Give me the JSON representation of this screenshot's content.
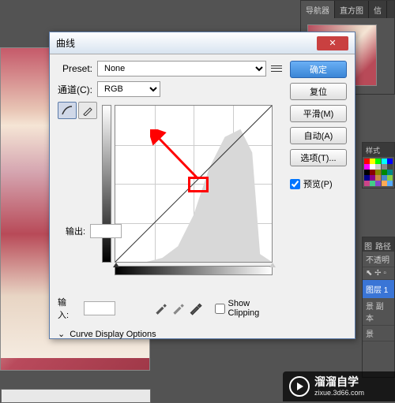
{
  "nav": {
    "tabs": [
      "导航器",
      "直方图",
      "信"
    ]
  },
  "color_panel": {
    "tab": "样式"
  },
  "layers": {
    "tab1": "图",
    "tab2": "路径",
    "opacity_label": "不透明",
    "layer1": "图层 1",
    "layer2": "景 副本",
    "layer3": "景"
  },
  "dialog": {
    "title": "曲线",
    "preset_label": "Preset:",
    "preset_value": "None",
    "channel_label": "通道(C):",
    "channel_value": "RGB",
    "output_label": "输出:",
    "input_label": "输入:",
    "show_clipping": "Show Clipping",
    "curve_options": "Curve Display Options",
    "buttons": {
      "ok": "确定",
      "reset": "复位",
      "smooth": "平滑(M)",
      "auto": "自动(A)",
      "options": "选项(T)..."
    },
    "preview_label": "预览(P)"
  },
  "chart_data": {
    "type": "line",
    "title": "Curves",
    "xlabel": "输入",
    "ylabel": "输出",
    "xlim": [
      0,
      255
    ],
    "ylim": [
      0,
      255
    ],
    "series": [
      {
        "name": "curve",
        "values": [
          [
            0,
            0
          ],
          [
            255,
            255
          ]
        ]
      }
    ],
    "histogram_peak_range": [
      120,
      220
    ],
    "annotations": [
      "red highlight at center indicating curve midpoint drag direction"
    ]
  },
  "watermark": {
    "text": "溜溜自学",
    "sub": "zixue.3d66.com"
  }
}
